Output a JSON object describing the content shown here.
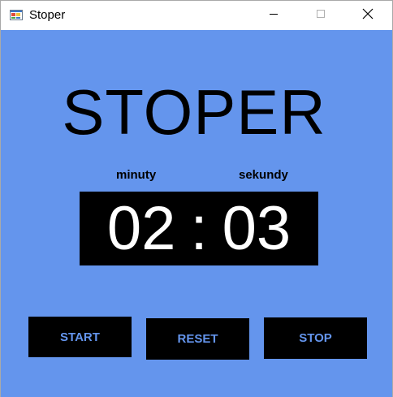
{
  "window": {
    "title": "Stoper",
    "icon": "app-window-icon",
    "controls": [
      "minimize-icon",
      "maximize-icon",
      "close-icon"
    ]
  },
  "app": {
    "heading": "STOPER",
    "labels": {
      "minutes": "minuty",
      "seconds": "sekundy"
    },
    "display": {
      "minutes": "02",
      "separator": ":",
      "seconds": "03"
    },
    "buttons": {
      "start": "START",
      "reset": "RESET",
      "stop": "STOP"
    }
  },
  "colors": {
    "background": "#6495ed",
    "display_bg": "#000000",
    "display_text": "#ffffff",
    "button_bg": "#000000",
    "button_text": "#6495ed"
  }
}
